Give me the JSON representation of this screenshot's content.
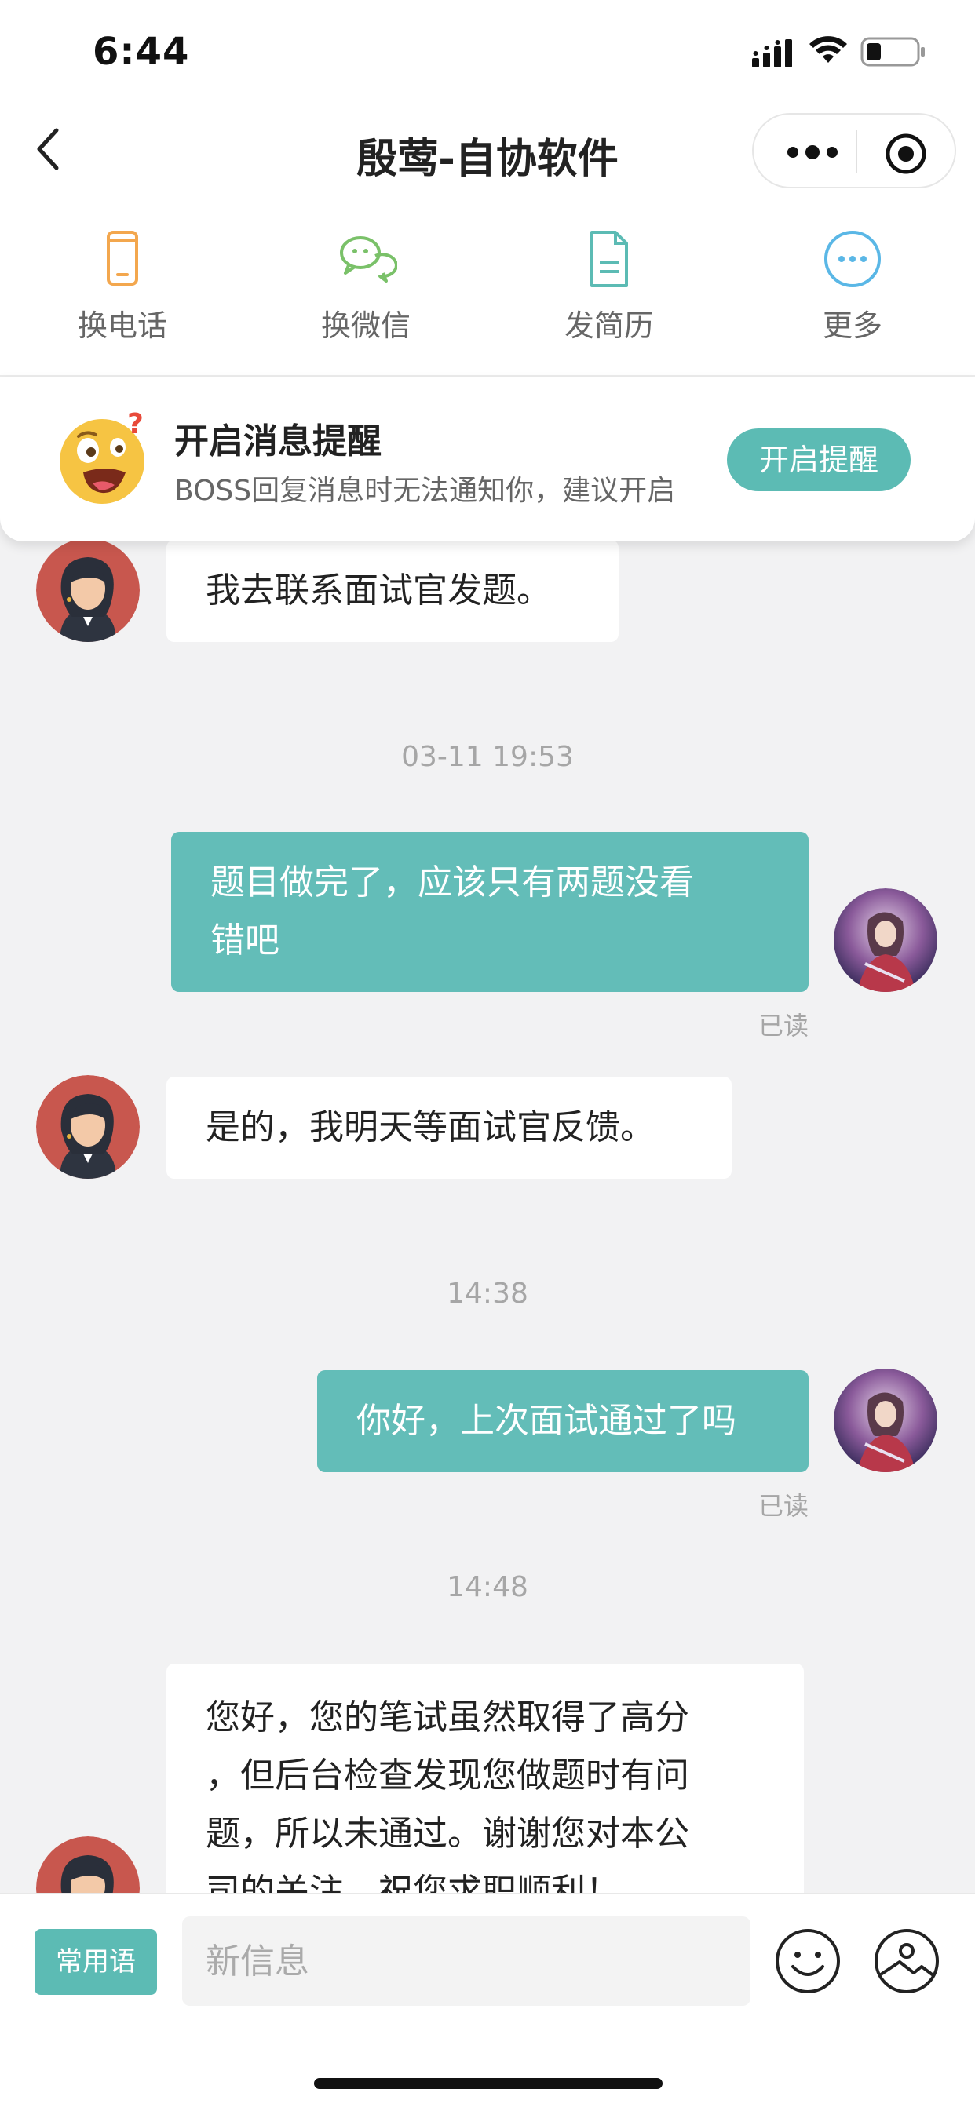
{
  "status_bar": {
    "time": "6:44"
  },
  "nav": {
    "title": "殷莺-自协软件"
  },
  "actions": [
    {
      "label": "换电话",
      "icon": "phone-icon"
    },
    {
      "label": "换微信",
      "icon": "wechat-icon"
    },
    {
      "label": "发简历",
      "icon": "resume-icon"
    },
    {
      "label": "更多",
      "icon": "more-icon"
    }
  ],
  "notice": {
    "title": "开启消息提醒",
    "desc": "BOSS回复消息时无法通知你，建议开启",
    "button": "开启提醒"
  },
  "messages": [
    {
      "side": "left",
      "text": "我去联系面试官发题。"
    },
    {
      "timestamp": "03-11 19:53"
    },
    {
      "side": "right",
      "line1": "题目做完了，应该只有两题没看",
      "line2": "错吧",
      "status": "已读"
    },
    {
      "side": "left",
      "text": "是的，我明天等面试官反馈。"
    },
    {
      "timestamp": "14:38"
    },
    {
      "side": "right",
      "text": "你好，上次面试通过了吗",
      "status": "已读"
    },
    {
      "timestamp": "14:48"
    },
    {
      "side": "left",
      "line1": "您好，您的笔试虽然取得了高分",
      "line2": "，但后台检查发现您做题时有问",
      "line3": "题，所以未通过。谢谢您对本公",
      "line4": "司的关注，祝您求职顺利！"
    }
  ],
  "input": {
    "phrase_button": "常用语",
    "placeholder": "新信息"
  },
  "colors": {
    "accent": "#5cbbb4",
    "bubble_right": "#63bdb8",
    "background": "#f2f2f3"
  }
}
